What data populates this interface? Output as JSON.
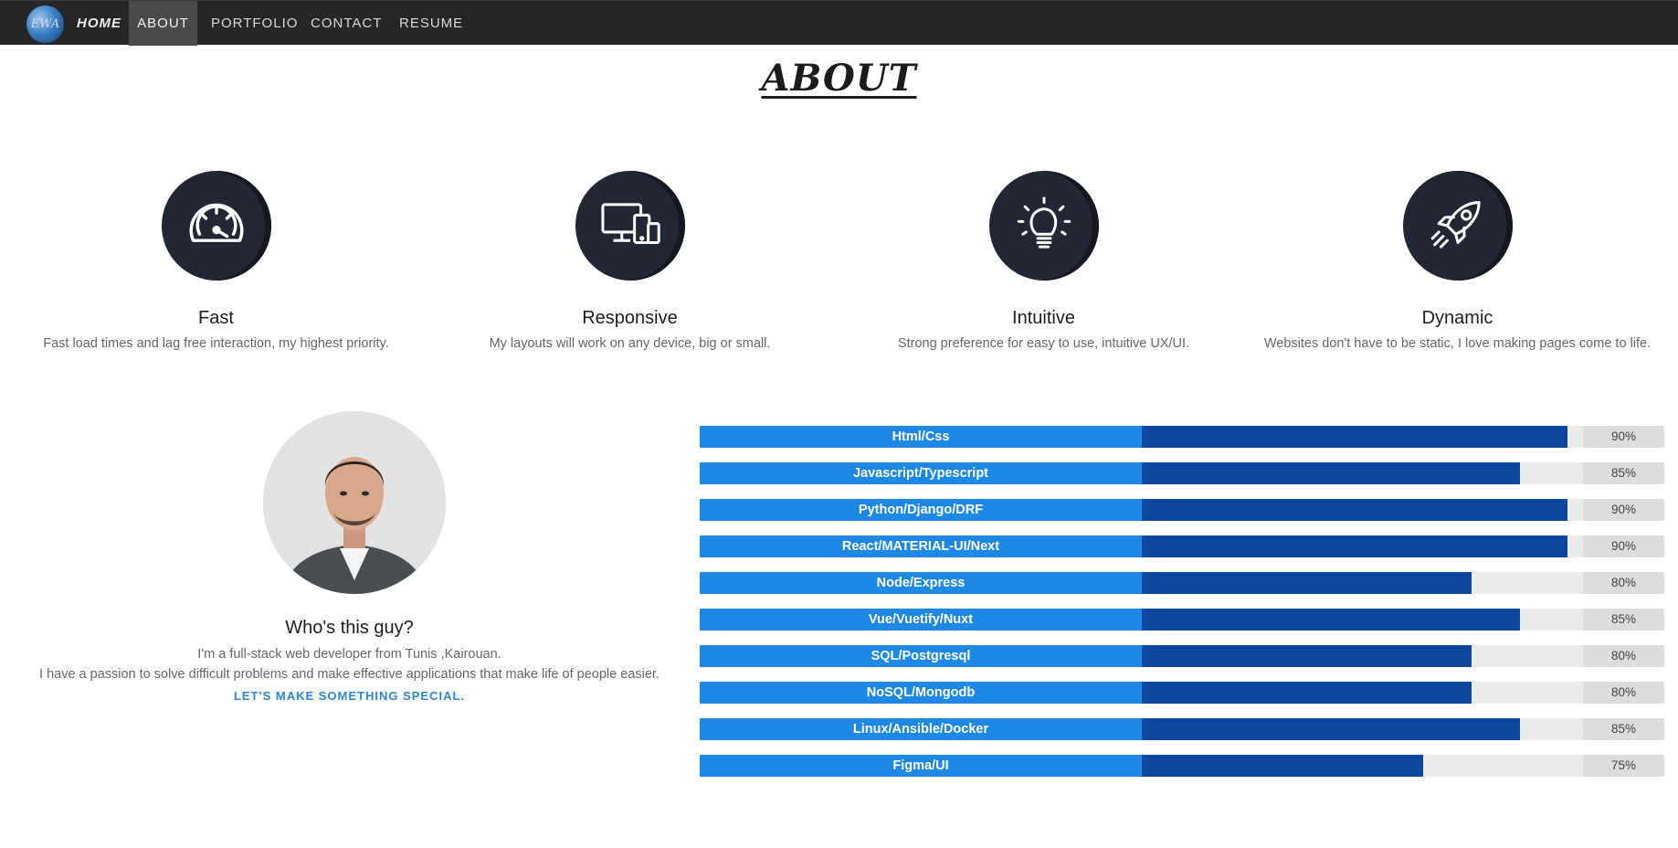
{
  "nav": {
    "logo_text": "EWA",
    "items": [
      {
        "label": "HOME"
      },
      {
        "label": "ABOUT"
      },
      {
        "label": "PORTFOLIO"
      },
      {
        "label": "CONTACT"
      },
      {
        "label": "RESUME"
      }
    ]
  },
  "section_title": "ABOUT",
  "features": [
    {
      "title": "Fast",
      "desc": "Fast load times and lag free interaction, my highest priority.",
      "icon": "speedometer-icon"
    },
    {
      "title": "Responsive",
      "desc": "My layouts will work on any device, big or small.",
      "icon": "devices-icon"
    },
    {
      "title": "Intuitive",
      "desc": "Strong preference for easy to use, intuitive UX/UI.",
      "icon": "lightbulb-icon"
    },
    {
      "title": "Dynamic",
      "desc": "Websites don't have to be static, I love making pages come to life.",
      "icon": "rocket-icon"
    }
  ],
  "about": {
    "heading": "Who's this guy?",
    "bio_line1": "I'm a full-stack web developer from Tunis ,Kairouan.",
    "bio_line2": "I have a passion to solve difficult problems and make effective applications that make life of people easier.",
    "cta": "LET'S MAKE SOMETHING SPECIAL."
  },
  "skills": [
    {
      "name": "Html/Css",
      "percent": "90%",
      "value": 90
    },
    {
      "name": "Javascript/Typescript",
      "percent": "85%",
      "value": 85
    },
    {
      "name": "Python/Django/DRF",
      "percent": "90%",
      "value": 90
    },
    {
      "name": "React/MATERIAL-UI/Next",
      "percent": "90%",
      "value": 90
    },
    {
      "name": "Node/Express",
      "percent": "80%",
      "value": 80
    },
    {
      "name": "Vue/Vuetify/Nuxt",
      "percent": "85%",
      "value": 85
    },
    {
      "name": "SQL/Postgresql",
      "percent": "80%",
      "value": 80
    },
    {
      "name": "NoSQL/Mongodb",
      "percent": "80%",
      "value": 80
    },
    {
      "name": "Linux/Ansible/Docker",
      "percent": "85%",
      "value": 85
    },
    {
      "name": "Figma/UI",
      "percent": "75%",
      "value": 75
    }
  ],
  "colors": {
    "navbar_bg": "#262626",
    "skill_label_bg": "#1e88e5",
    "skill_fill": "#0d47a1",
    "cta": "#2a86d1",
    "icon_circle": "#232733"
  }
}
